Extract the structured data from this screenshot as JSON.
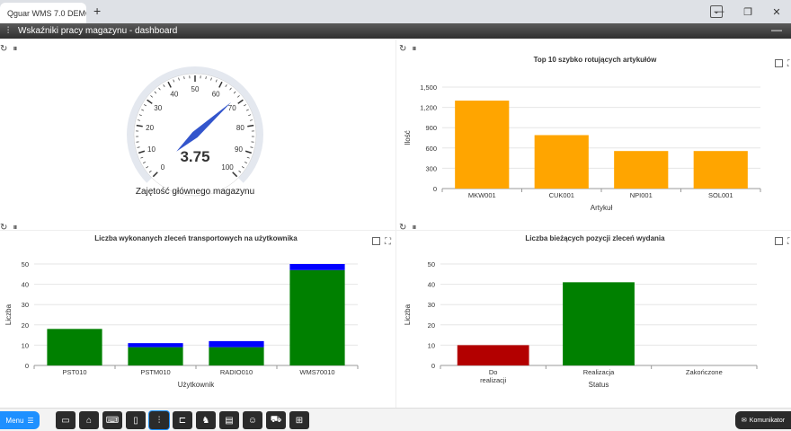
{
  "browser": {
    "tab_title": "Qguar WMS 7.0 DEMO",
    "new_tab_label": "+",
    "min_label": "—",
    "restore_label": "❐",
    "close_label": "✕",
    "dropdown_label": "⌄"
  },
  "window": {
    "title": "Wskaźniki pracy magazynu - dashboard",
    "minimize_label": "—"
  },
  "panels": {
    "gauge": {
      "value": "3.75",
      "label": "Zajętość głównego magazynu",
      "gauge_value": 3.75,
      "gauge_max": 100,
      "ticks": [
        "0",
        "10",
        "20",
        "30",
        "40",
        "50",
        "60",
        "70",
        "80",
        "90",
        "100"
      ]
    },
    "top_articles": {
      "title": "Top 10 szybko rotujących artykułów"
    },
    "transport_orders": {
      "title": "Liczba wykonanych zleceń transportowych na użytkownika"
    },
    "release_orders": {
      "title": "Liczba bieżących pozycji zleceń wydania"
    }
  },
  "icons": {
    "refresh": "refresh-icon",
    "pause": "pause-icon",
    "expand": "expand-icon",
    "fullscreen": "fullscreen-icon"
  },
  "colors": {
    "orange": "#FFA500",
    "green": "#008000",
    "blue": "#0000FF",
    "red": "#B30000",
    "needle": "#3355cc",
    "menu": "#1e90ff"
  },
  "chart_data": [
    {
      "type": "bar",
      "title": "Top 10 szybko rotujących artykułów",
      "xlabel": "Artykuł",
      "ylabel": "Ilość",
      "categories": [
        "MKW001",
        "CUK001",
        "NPI001",
        "SOL001"
      ],
      "values": [
        1300,
        790,
        555,
        555
      ],
      "ylim": [
        0,
        1500
      ],
      "yticks": [
        "0",
        "300",
        "600",
        "900",
        "1,200",
        "1,500"
      ],
      "color": "#FFA500",
      "grid": true
    },
    {
      "type": "bar",
      "stacked": true,
      "title": "Liczba wykonanych zleceń transportowych na użytkownika",
      "xlabel": "Użytkownik",
      "ylabel": "Liczba",
      "categories": [
        "PST010",
        "PSTM010",
        "RADIO010",
        "WMS70010"
      ],
      "series": [
        {
          "values": [
            18,
            9,
            9,
            47
          ],
          "color": "#008000"
        },
        {
          "values": [
            0,
            2,
            3,
            3
          ],
          "color": "#0000FF"
        }
      ],
      "ylim": [
        0,
        50
      ],
      "yticks": [
        "0",
        "10",
        "20",
        "30",
        "40",
        "50"
      ],
      "grid": true
    },
    {
      "type": "bar",
      "title": "Liczba bieżących pozycji zleceń wydania",
      "xlabel": "Status",
      "ylabel": "Liczba",
      "categories": [
        "Do realizacji",
        "Realizacja",
        "Zakończone"
      ],
      "values": [
        10,
        41,
        0
      ],
      "colors": [
        "#B30000",
        "#008000",
        "#008000"
      ],
      "ylim": [
        0,
        50
      ],
      "yticks": [
        "0",
        "10",
        "20",
        "30",
        "40",
        "50"
      ],
      "grid": true
    }
  ],
  "taskbar": {
    "menu_label": "Menu",
    "komunikator_label": "Komunikator",
    "icons": [
      "screen-icon",
      "warehouse-icon",
      "keyboard-icon",
      "document-icon",
      "sliders-icon",
      "truck-ramp-icon",
      "forklift-icon",
      "report-icon",
      "chat-icon",
      "delivery-truck-icon",
      "grid-icon"
    ]
  }
}
